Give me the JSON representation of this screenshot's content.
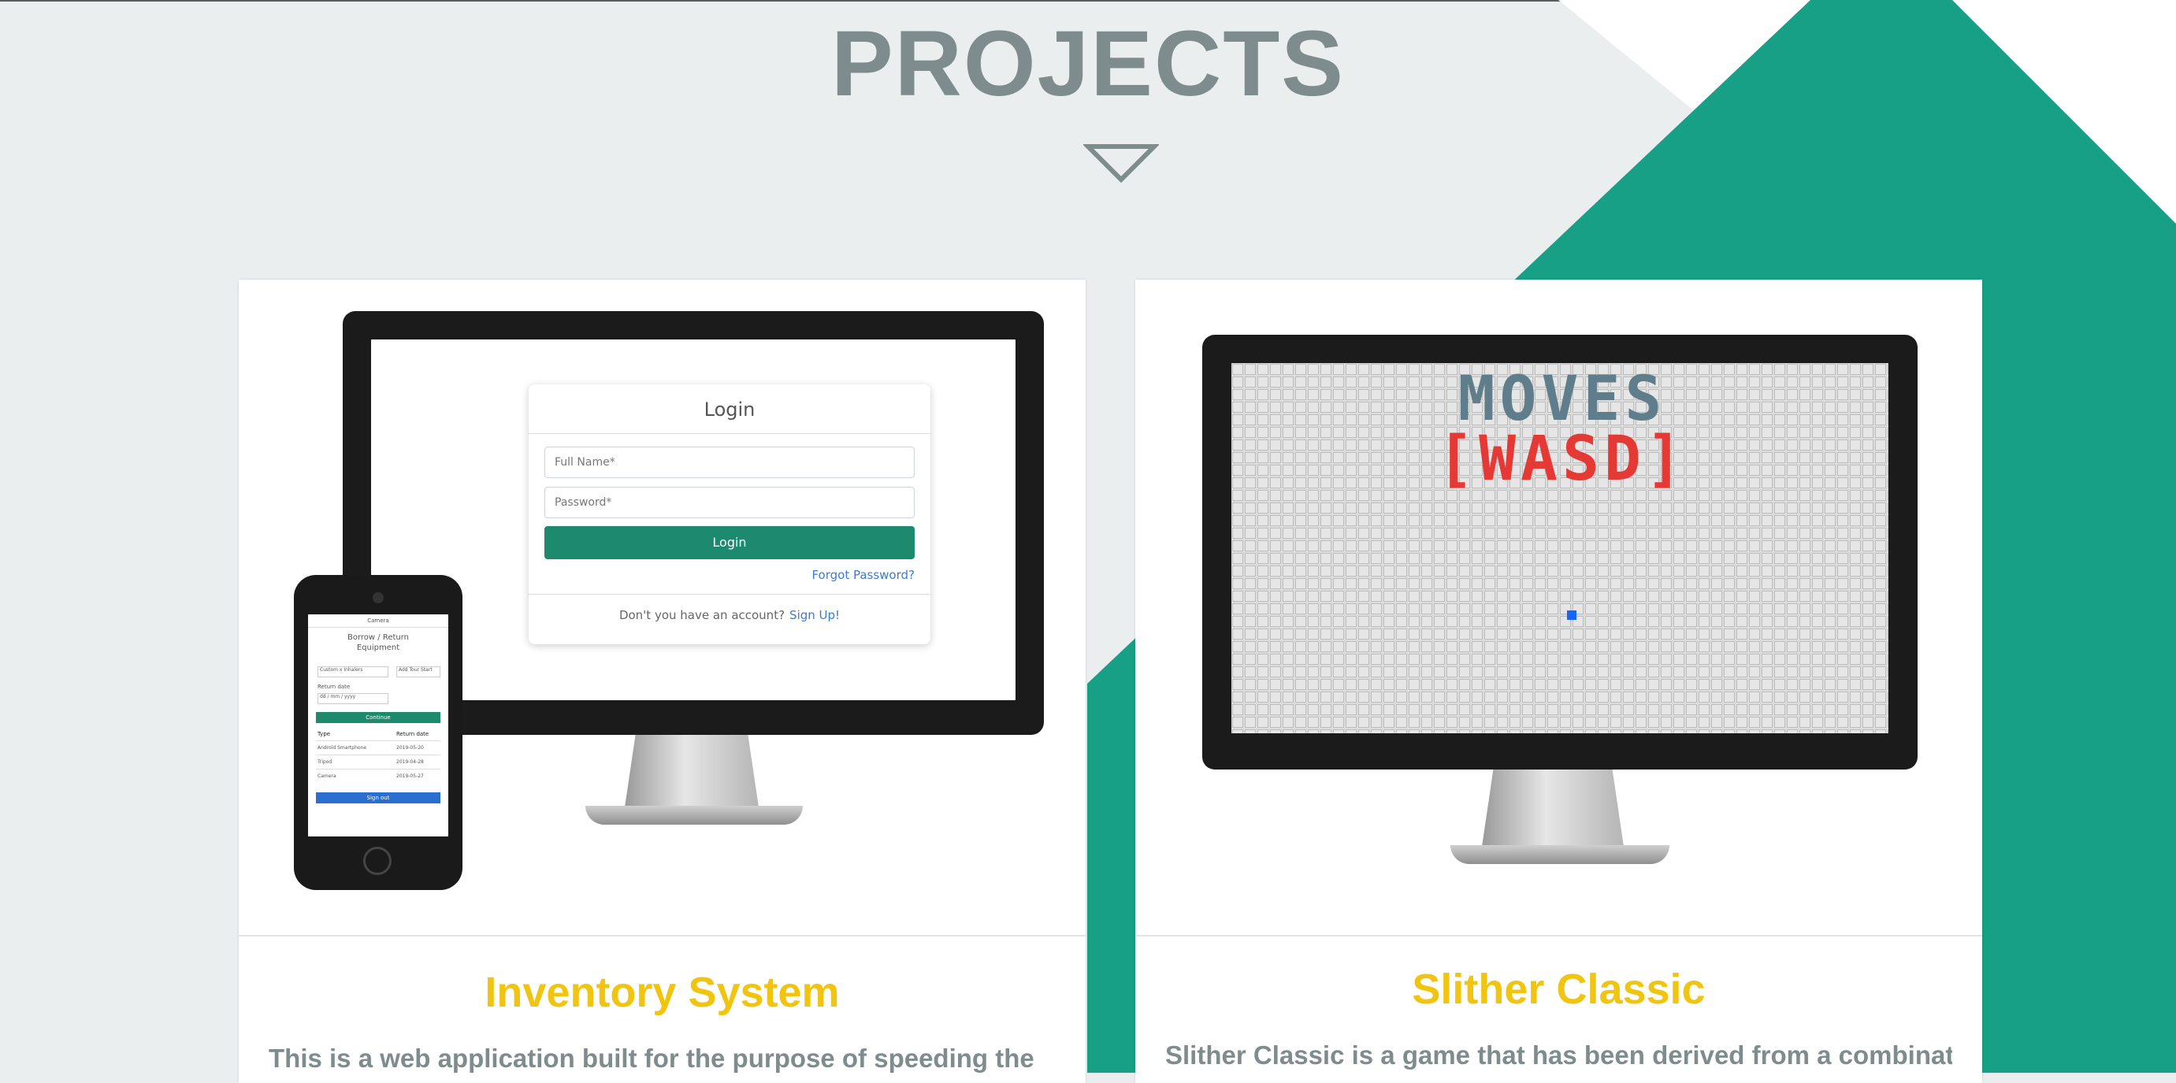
{
  "section": {
    "title": "PROJECTS",
    "arrow_icon": "triangle-down-outline-icon"
  },
  "colors": {
    "accent_teal": "#17a085",
    "title_gray": "#7f8c8d",
    "card_title_yellow": "#f1c40f",
    "background": "#eaeeef"
  },
  "projects": [
    {
      "title": "Inventory System",
      "description": "This is a web application built for the purpose of speeding the",
      "preview": {
        "login_title": "Login",
        "full_name_placeholder": "Full Name*",
        "password_placeholder": "Password*",
        "login_button": "Login",
        "forgot_link": "Forgot Password?",
        "no_account_text": "Don't you have an account?",
        "signup_link": "Sign Up!",
        "phone": {
          "header": "Camera",
          "title_line1": "Borrow / Return",
          "title_line2": "Equipment",
          "search_left": "Custom x Inhalers",
          "search_right": "Add Tour Start",
          "return_label": "Return date",
          "date_value": "dd / mm / yyyy",
          "submit_button": "Continue",
          "col_type": "Type",
          "col_date": "Return date",
          "rows": [
            {
              "type": "Android Smartphone",
              "date": "2019-05-20"
            },
            {
              "type": "Tripod",
              "date": "2019-04-28"
            },
            {
              "type": "Camera",
              "date": "2019-05-27"
            }
          ],
          "bottom_button": "Sign out"
        }
      }
    },
    {
      "title": "Slither Classic",
      "description": "Slither Classic is a game that has been derived from a combination",
      "preview": {
        "moves_text": "MOVES",
        "keys_text": "[WASD]"
      }
    }
  ]
}
